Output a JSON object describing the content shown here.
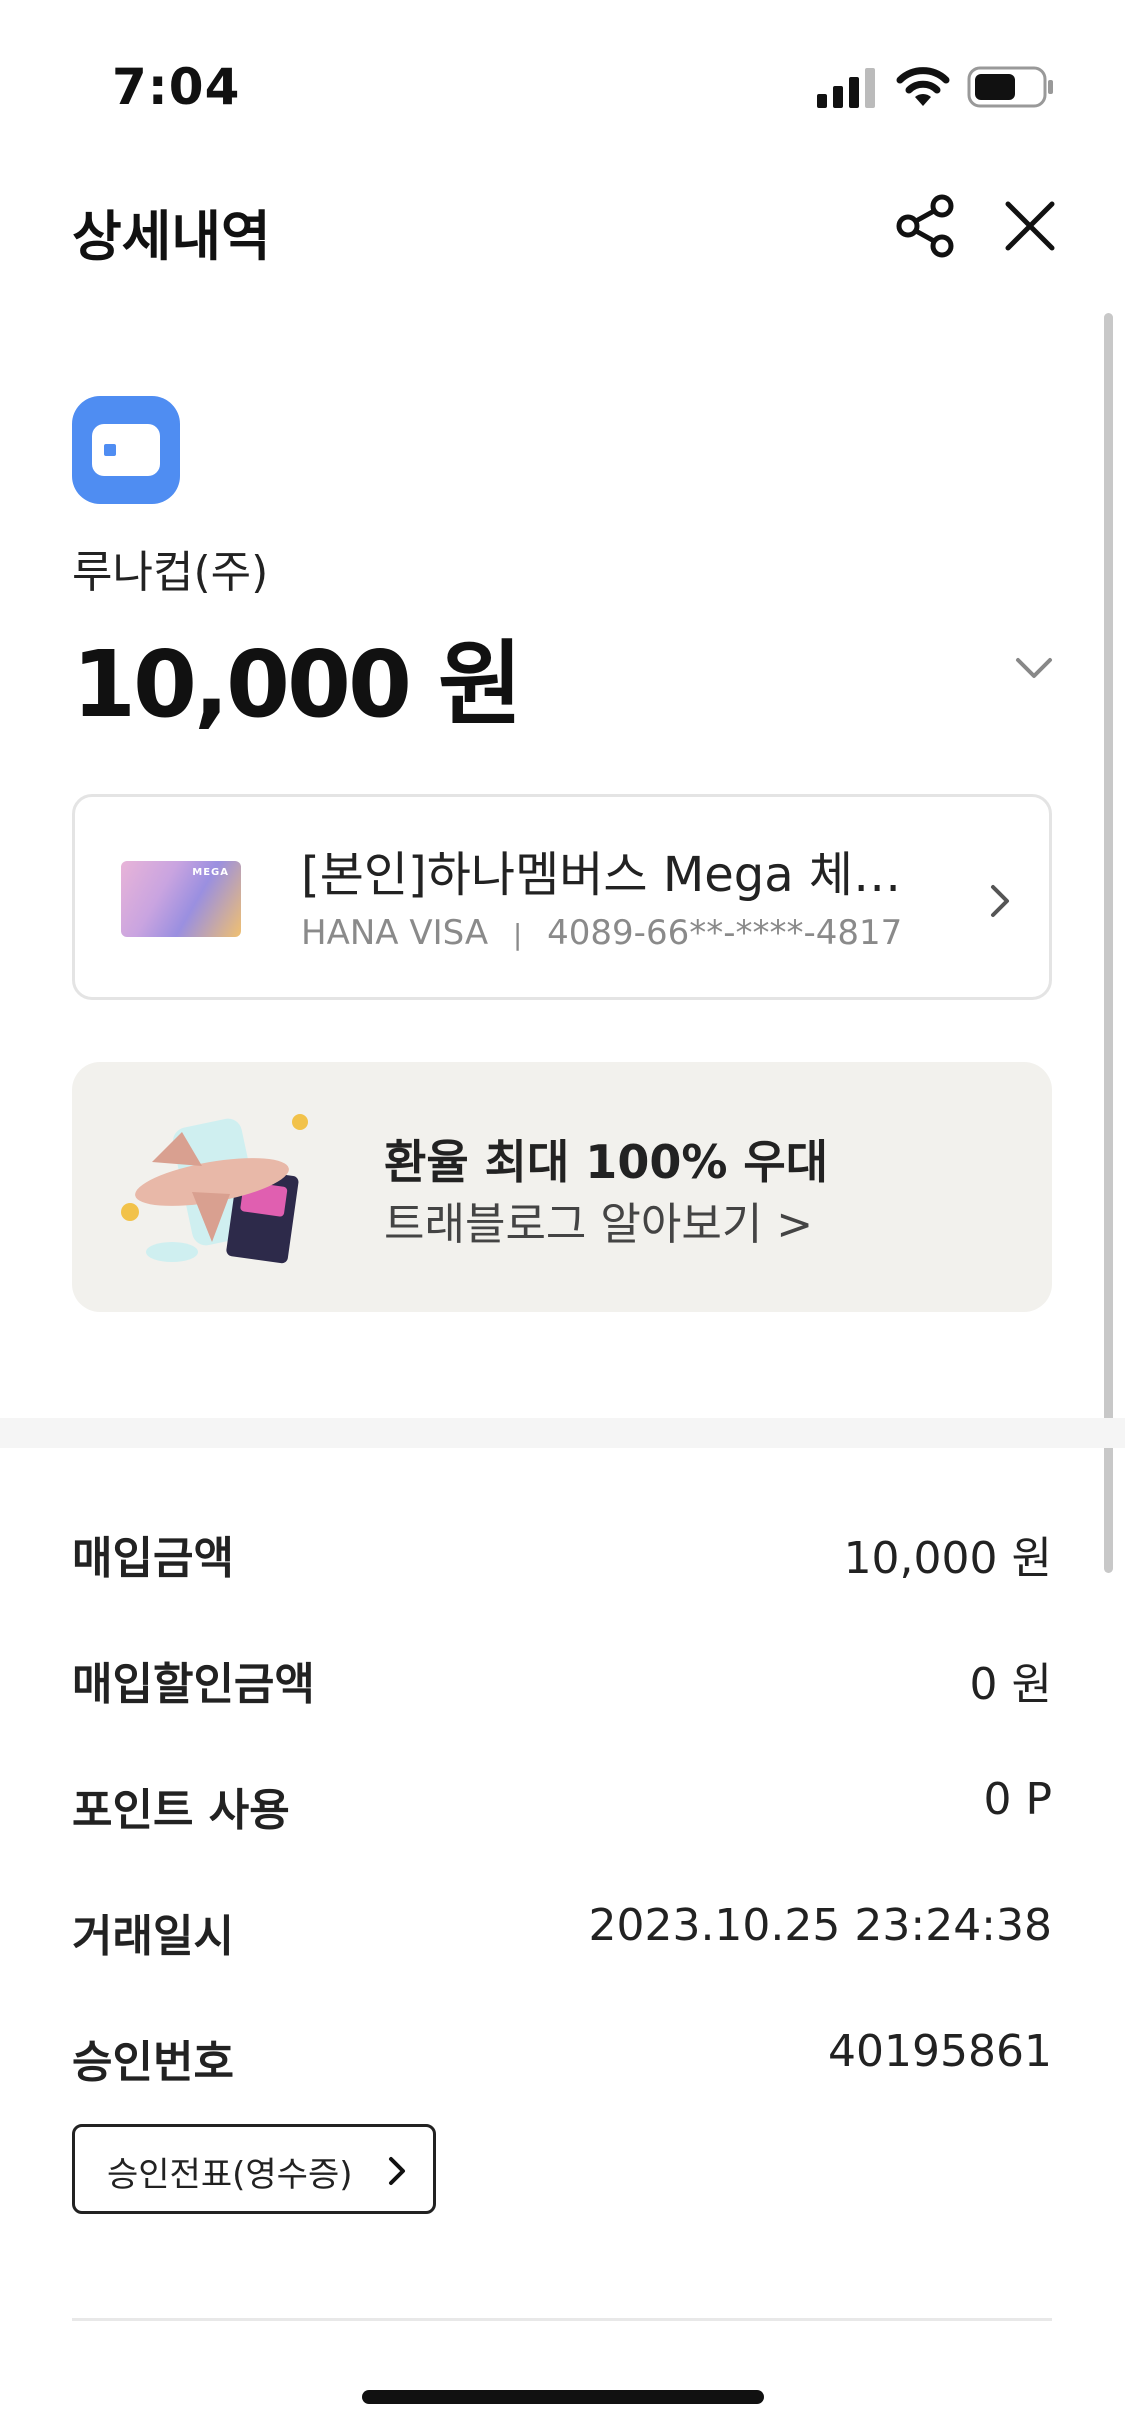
{
  "status_bar": {
    "time": "7:04"
  },
  "header": {
    "title": "상세내역"
  },
  "merchant": {
    "name": "루나컵(주)",
    "amount": "10,000 원"
  },
  "card": {
    "name": "[본인]하나멤버스 Mega 체…",
    "brand": "HANA VISA",
    "separator": "|",
    "number": "4089-66**-****-4817",
    "image_text": "MEGA"
  },
  "promo": {
    "title": "환율 최대 100% 우대",
    "link": "트래블로그 알아보기 >"
  },
  "details": [
    {
      "label": "매입금액",
      "value": "10,000 원"
    },
    {
      "label": "매입할인금액",
      "value": "0 원"
    },
    {
      "label": "포인트 사용",
      "value": "0 P"
    },
    {
      "label": "거래일시",
      "value": "2023.10.25 23:24:38"
    },
    {
      "label": "승인번호",
      "value": "40195861"
    }
  ],
  "receipt_button": {
    "label": "승인전표(영수증)"
  },
  "colors": {
    "accent": "#4f8df2",
    "promo_bg": "#f2f1ed",
    "border": "#e4e4e4"
  }
}
